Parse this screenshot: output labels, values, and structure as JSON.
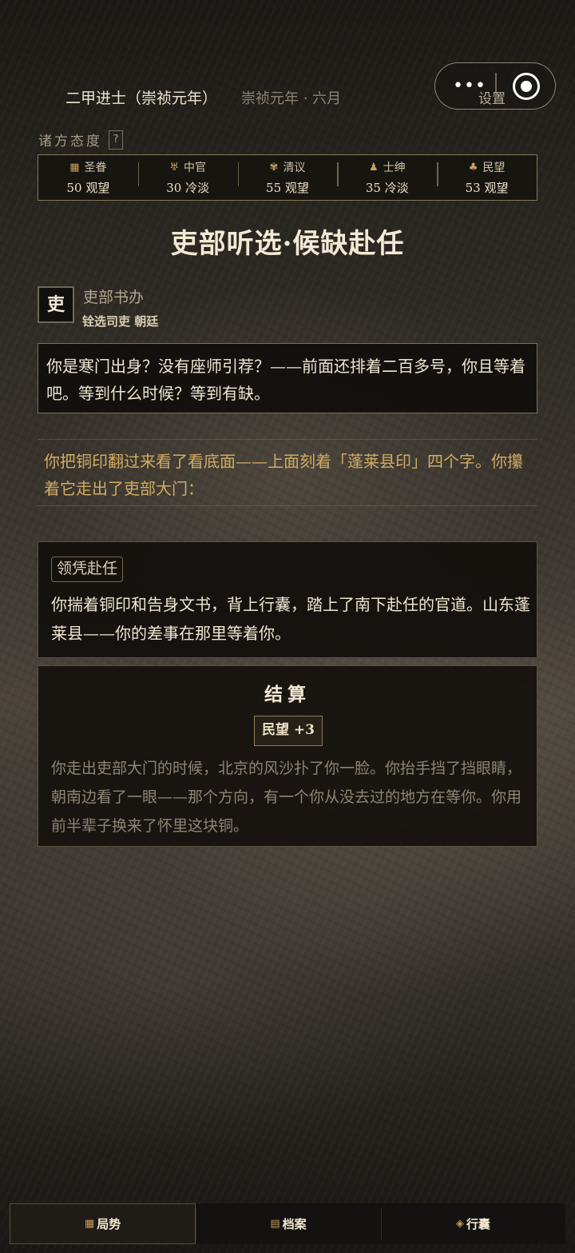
{
  "status": {
    "rank": "二甲进士（崇祯元年）",
    "date": "崇祯元年 · 六月"
  },
  "capsule": {
    "more": "•••",
    "settings": "设置"
  },
  "attitudes": {
    "label": "诸方态度",
    "help": "?",
    "items": [
      {
        "icon": "▦",
        "name": "圣眷",
        "value": "50",
        "state": "观望"
      },
      {
        "icon": "♅",
        "name": "中官",
        "value": "30",
        "state": "冷淡"
      },
      {
        "icon": "✾",
        "name": "清议",
        "value": "55",
        "state": "观望"
      },
      {
        "icon": "♟",
        "name": "士绅",
        "value": "35",
        "state": "冷淡"
      },
      {
        "icon": "♣",
        "name": "民望",
        "value": "53",
        "state": "观望"
      }
    ]
  },
  "scene": {
    "title": "吏部听选·候缺赴任"
  },
  "npc": {
    "badge": "吏",
    "name": "吏部书办",
    "subtitle": "铨选司吏 朝廷"
  },
  "dialogue": "你是寒门出身？没有座师引荐？——前面还排着二百多号，你且等着吧。等到什么时候？等到有缺。",
  "narration": "你把铜印翻过来看了看底面——上面刻着「蓬莱县印」四个字。你攥着它走出了吏部大门：",
  "choice": {
    "tag": "领凭赴任",
    "text": "你揣着铜印和告身文书，背上行囊，踏上了南下赴任的官道。山东蓬莱县——你的差事在那里等着你。"
  },
  "result": {
    "title": "结算",
    "badge": "民望 +3",
    "text": "你走出吏部大门的时候，北京的风沙扑了你一脸。你抬手挡了挡眼睛，朝南边看了一眼——那个方向，有一个你从没去过的地方在等你。你用前半辈子换来了怀里这块铜。"
  },
  "tabs": [
    {
      "icon": "▦",
      "label": "局势"
    },
    {
      "icon": "▤",
      "label": "档案"
    },
    {
      "icon": "◈",
      "label": "行囊"
    }
  ]
}
